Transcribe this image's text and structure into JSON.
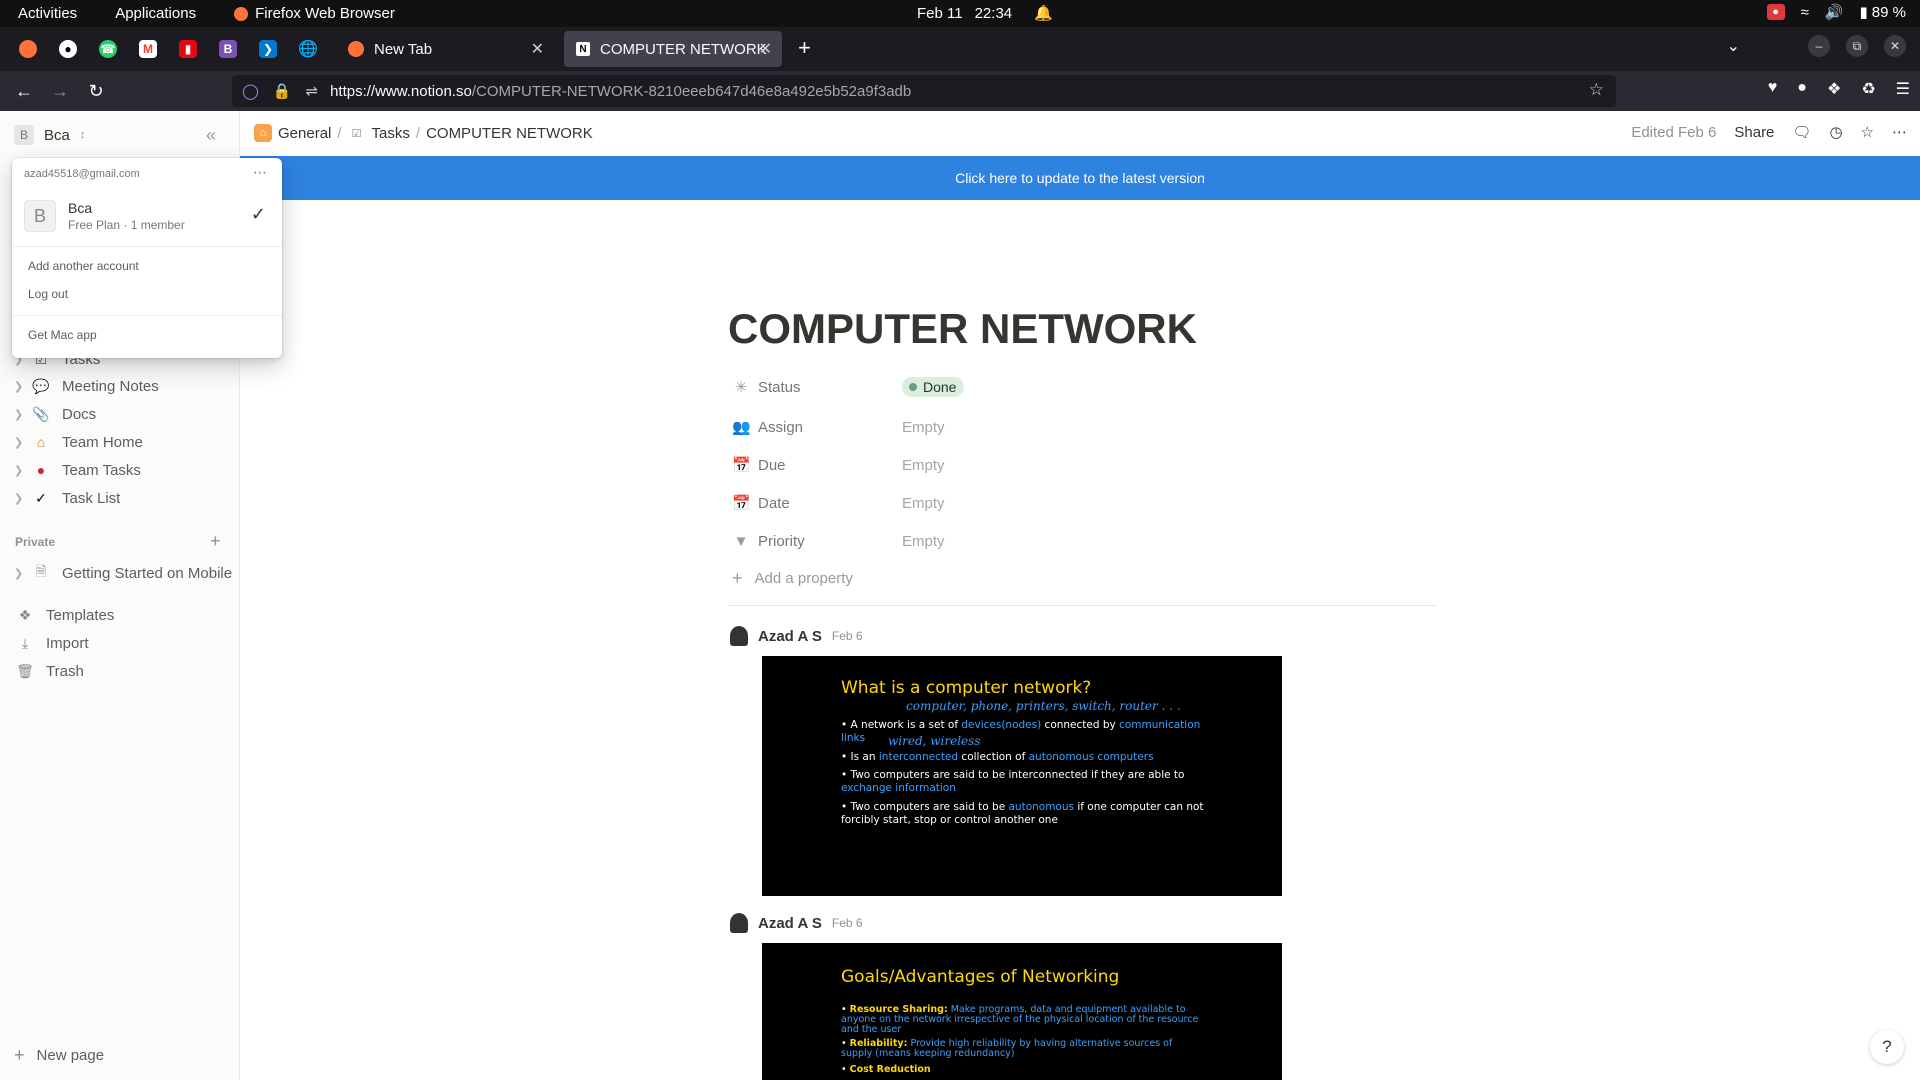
{
  "system": {
    "activities": "Activities",
    "applications": "Applications",
    "active_app": "Firefox Web Browser",
    "date": "Feb 11",
    "time": "22:34",
    "battery": "89 %"
  },
  "browser": {
    "tabs": [
      {
        "title": "New Tab"
      },
      {
        "title": "COMPUTER NETWORK"
      }
    ],
    "url_host": "https://www.notion.so",
    "url_path": "/COMPUTER-NETWORK-8210eeeb647d46e8a492e5b52a9f3adb"
  },
  "workspace": {
    "name": "Bca",
    "initial": "B"
  },
  "account_menu": {
    "email": "azad45518@gmail.com",
    "workspace_name": "Bca",
    "workspace_plan": "Free Plan · 1 member",
    "add_account": "Add another account",
    "logout": "Log out",
    "get_app": "Get Mac app"
  },
  "sidebar": {
    "items": [
      {
        "label": "Tasks"
      },
      {
        "label": "Meeting Notes"
      },
      {
        "label": "Docs"
      },
      {
        "label": "Team Home"
      },
      {
        "label": "Team Tasks"
      },
      {
        "label": "Task List"
      }
    ],
    "private_title": "Private",
    "private_items": [
      {
        "label": "Getting Started on Mobile"
      }
    ],
    "utils": [
      {
        "label": "Templates"
      },
      {
        "label": "Import"
      },
      {
        "label": "Trash"
      }
    ],
    "new_page": "New page"
  },
  "topbar": {
    "breadcrumbs": [
      "General",
      "Tasks",
      "COMPUTER NETWORK"
    ],
    "edited": "Edited Feb 6",
    "share": "Share"
  },
  "banner": "Click here to update to the latest version",
  "page": {
    "title": "COMPUTER NETWORK",
    "properties": [
      {
        "label": "Status",
        "value": "Done"
      },
      {
        "label": "Assign",
        "value": "Empty"
      },
      {
        "label": "Due",
        "value": "Empty"
      },
      {
        "label": "Date",
        "value": "Empty"
      },
      {
        "label": "Priority",
        "value": "Empty"
      }
    ],
    "add_property": "Add a property"
  },
  "comments": [
    {
      "author": "Azad A S",
      "date": "Feb 6",
      "slide": {
        "title": "What is a computer network?",
        "scribble1": "computer, phone, printers, switch, router . . .",
        "scribble2": "wired, wireless",
        "b1_pre": "A network is a set of ",
        "b1_hl1": "devices(nodes)",
        "b1_mid": " connected by ",
        "b1_hl2": "communication links",
        "b2_pre": "Is an ",
        "b2_hl1": "interconnected",
        "b2_mid": " collection of ",
        "b2_hl2": "autonomous computers",
        "b3_pre": "Two computers are said to be interconnected if they are able to ",
        "b3_hl": "exchange information",
        "b4_pre": "Two computers are said to be ",
        "b4_hl": "autonomous",
        "b4_post": " if one computer can not forcibly start, stop or control another one"
      }
    },
    {
      "author": "Azad A S",
      "date": "Feb 6",
      "slide": {
        "title": "Goals/Advantages of Networking",
        "g1_head": "Resource Sharing:",
        "g1_text": " Make programs, data and equipment available to anyone on the network irrespective of the physical location of the resource and the user",
        "g2_head": "Reliability:",
        "g2_text": " Provide high reliability by having alternative sources of supply (means keeping redundancy)",
        "g3_head": "Cost Reduction"
      }
    }
  ],
  "help": "?"
}
